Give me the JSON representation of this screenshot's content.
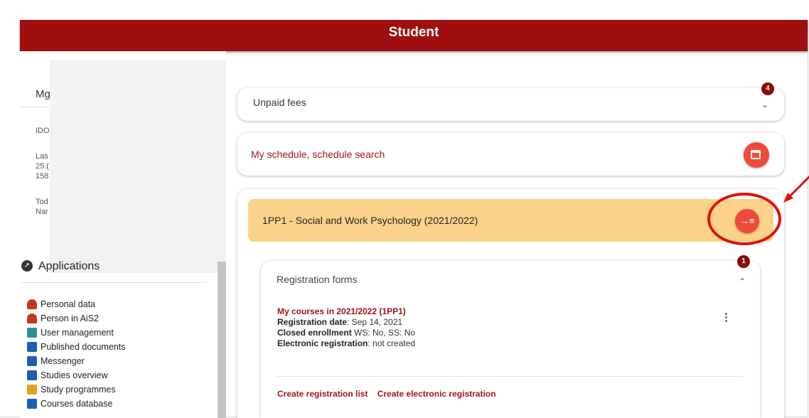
{
  "header": {
    "title": "Student"
  },
  "sidebar": {
    "initial": "Mg",
    "info_lines": [
      "IDO",
      "Las",
      "25.(",
      "158",
      "Tod",
      "Nar"
    ],
    "applications_title": "Applications",
    "applications": [
      {
        "label": "Personal data",
        "icon": "person-icon",
        "color": "#c0391b"
      },
      {
        "label": "Person in AiS2",
        "icon": "person-icon",
        "color": "#c0391b"
      },
      {
        "label": "User management",
        "icon": "org-chart-icon",
        "color": "#2f8f9d"
      },
      {
        "label": "Published documents",
        "icon": "document-icon",
        "color": "#1b5fb0"
      },
      {
        "label": "Messenger",
        "icon": "chat-icon",
        "color": "#1b5fb0"
      },
      {
        "label": "Studies overview",
        "icon": "list-icon",
        "color": "#1b5fb0"
      },
      {
        "label": "Study programmes",
        "icon": "list-icon",
        "color": "#e0a020"
      },
      {
        "label": "Courses database",
        "icon": "folder-icon",
        "color": "#1b5fb0"
      }
    ]
  },
  "unpaid": {
    "label": "Unpaid fees",
    "badge": "4"
  },
  "schedule": {
    "label": "My schedule, schedule search"
  },
  "course": {
    "title": "1PP1 - Social and Work Psychology (2021/2022)",
    "button_icon": "→≡"
  },
  "registration": {
    "title": "Registration forms",
    "badge": "1",
    "entry_link": "My courses in 2021/2022 (1PP1)",
    "date_label": "Registration date",
    "date_value": ": Sep 14, 2021",
    "closed_label": "Closed enrollment",
    "closed_value": " WS: No,  SS: No",
    "electronic_label": "Electronic registration",
    "electronic_value": ": not created",
    "action_list": "Create registration list",
    "action_electronic": "Create electronic registration"
  },
  "colors": {
    "brand": "#a00f0f",
    "accent": "#ef4a3b",
    "highlight": "#fcd28a"
  }
}
